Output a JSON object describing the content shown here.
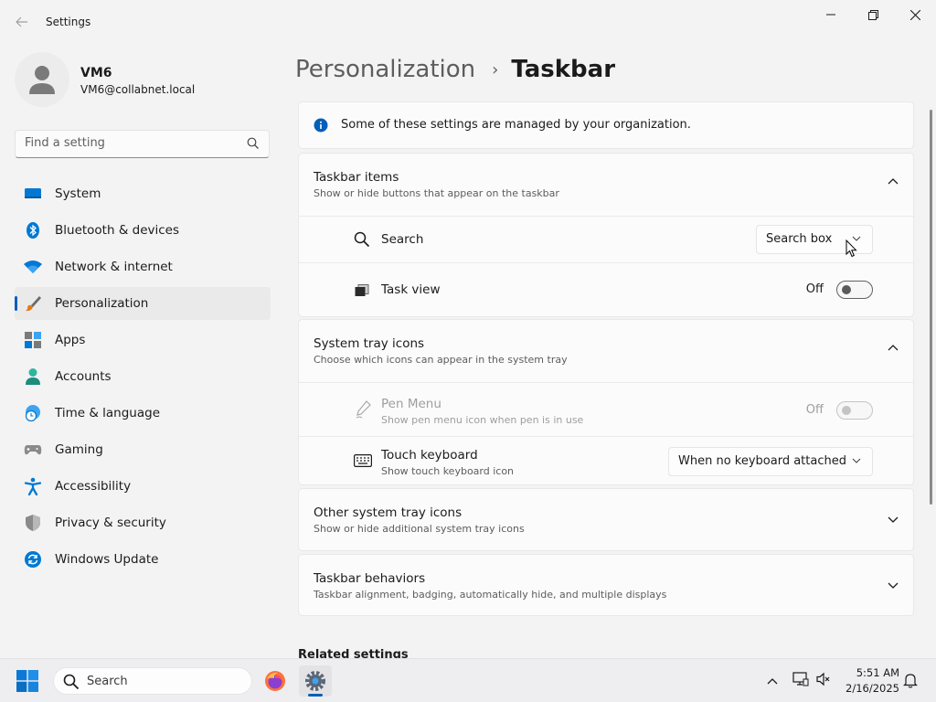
{
  "window": {
    "title": "Settings"
  },
  "profile": {
    "name": "VM6",
    "email": "VM6@collabnet.local"
  },
  "search": {
    "placeholder": "Find a setting"
  },
  "sidebar": {
    "items": [
      {
        "label": "System",
        "icon": "system-icon"
      },
      {
        "label": "Bluetooth & devices",
        "icon": "bluetooth-icon"
      },
      {
        "label": "Network & internet",
        "icon": "wifi-icon"
      },
      {
        "label": "Personalization",
        "icon": "brush-icon",
        "active": true
      },
      {
        "label": "Apps",
        "icon": "apps-icon"
      },
      {
        "label": "Accounts",
        "icon": "person-icon"
      },
      {
        "label": "Time & language",
        "icon": "globe-clock-icon"
      },
      {
        "label": "Gaming",
        "icon": "gamepad-icon"
      },
      {
        "label": "Accessibility",
        "icon": "accessibility-icon"
      },
      {
        "label": "Privacy & security",
        "icon": "shield-icon"
      },
      {
        "label": "Windows Update",
        "icon": "update-icon"
      }
    ]
  },
  "breadcrumb": {
    "parent": "Personalization",
    "separator": "›",
    "current": "Taskbar"
  },
  "notice": {
    "text": "Some of these settings are managed by your organization."
  },
  "taskbar_items": {
    "title": "Taskbar items",
    "subtitle": "Show or hide buttons that appear on the taskbar",
    "search": {
      "label": "Search",
      "value": "Search box"
    },
    "task_view": {
      "label": "Task view",
      "state": "Off"
    }
  },
  "system_tray": {
    "title": "System tray icons",
    "subtitle": "Choose which icons can appear in the system tray",
    "pen_menu": {
      "label": "Pen Menu",
      "subtitle": "Show pen menu icon when pen is in use",
      "state": "Off"
    },
    "touch_keyboard": {
      "label": "Touch keyboard",
      "subtitle": "Show touch keyboard icon",
      "value": "When no keyboard attached"
    }
  },
  "other_tray": {
    "title": "Other system tray icons",
    "subtitle": "Show or hide additional system tray icons"
  },
  "behaviors": {
    "title": "Taskbar behaviors",
    "subtitle": "Taskbar alignment, badging, automatically hide, and multiple displays"
  },
  "related": {
    "title": "Related settings"
  },
  "taskbar": {
    "search_label": "Search",
    "time": "5:51 AM",
    "date": "2/16/2025"
  },
  "colors": {
    "accent": "#005fb8",
    "background": "#f3f3f3",
    "card": "#fbfbfb"
  }
}
